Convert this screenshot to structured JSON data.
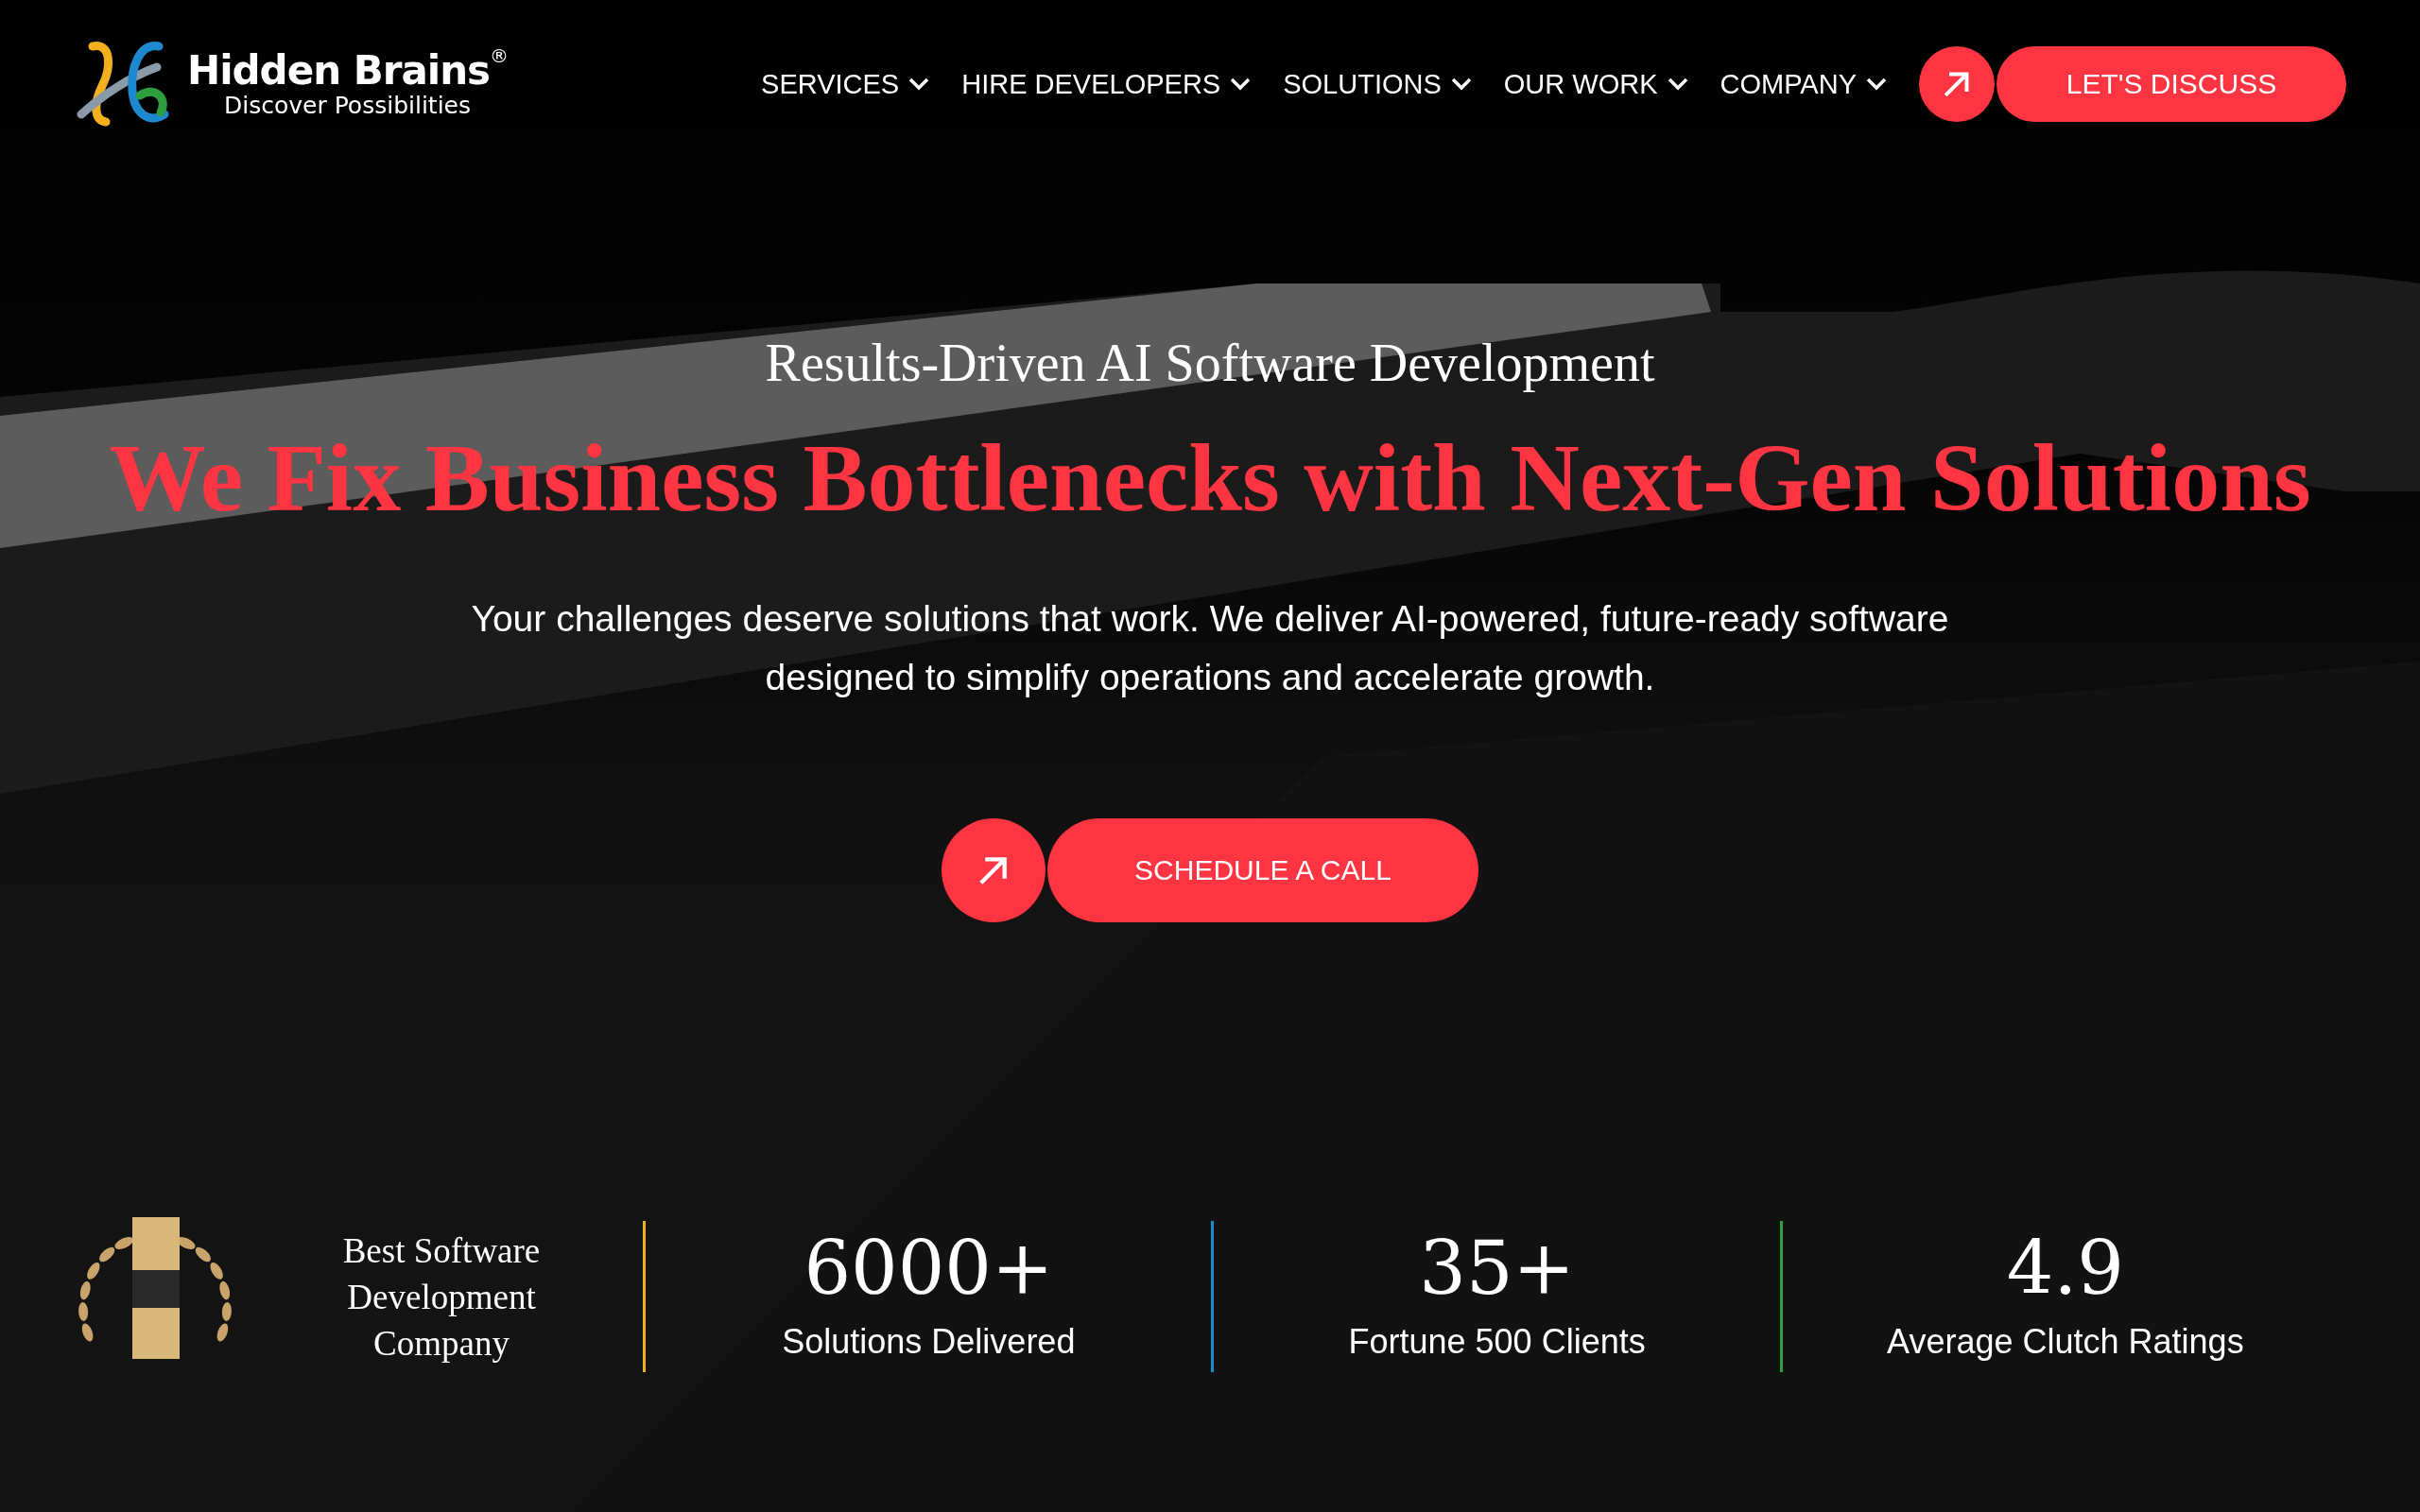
{
  "header": {
    "logo": {
      "name": "Hidden Brains$^{®}$",
      "tagline": "Discover Possibilities"
    },
    "nav": [
      {
        "label": "SERVICES"
      },
      {
        "label": "HIRE DEVELOPERS"
      },
      {
        "label": "SOLUTIONS"
      },
      {
        "label": "OUR WORK"
      },
      {
        "label": "COMPANY"
      }
    ],
    "cta": "LET'S DISCUSS"
  },
  "hero": {
    "eyebrow": "Results-Driven AI Software Development",
    "headline": "We Fix Business Bottlenecks with Next-Gen Solutions",
    "description": "Your challenges deserve solutions that work. We deliver AI-powered, future-ready software designed to simplify operations and accelerate growth.",
    "cta": "SCHEDULE A CALL"
  },
  "stats": {
    "award": "Best Software Development Company",
    "items": [
      {
        "value": "6000+",
        "label": "Solutions Delivered",
        "color": "#f2b01e"
      },
      {
        "value": "35+",
        "label": "Fortune 500 Clients",
        "color": "#1e88d0"
      },
      {
        "value": "4.9",
        "label": "Average Clutch Ratings",
        "color": "#2e9e3e"
      }
    ]
  }
}
